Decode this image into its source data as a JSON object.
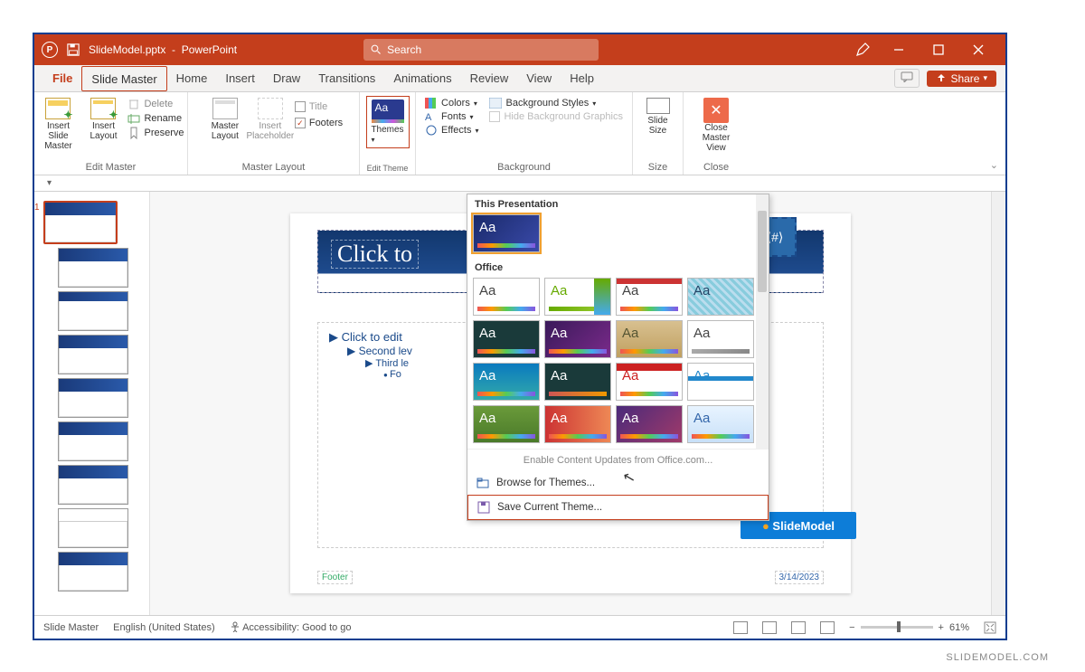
{
  "title": {
    "filename": "SlideModel.pptx",
    "app": "PowerPoint",
    "search_placeholder": "Search"
  },
  "tabs": {
    "file": "File",
    "slide_master": "Slide Master",
    "home": "Home",
    "insert": "Insert",
    "draw": "Draw",
    "transitions": "Transitions",
    "animations": "Animations",
    "review": "Review",
    "view": "View",
    "help": "Help",
    "share": "Share"
  },
  "ribbon": {
    "edit_master": {
      "label": "Edit Master",
      "insert_slide_master": "Insert Slide\nMaster",
      "insert_layout": "Insert\nLayout",
      "delete": "Delete",
      "rename": "Rename",
      "preserve": "Preserve"
    },
    "master_layout": {
      "label": "Master Layout",
      "master_layout_btn": "Master\nLayout",
      "insert_placeholder": "Insert\nPlaceholder",
      "title": "Title",
      "footers": "Footers"
    },
    "edit_theme": {
      "label": "Edit Theme",
      "themes": "Themes"
    },
    "background": {
      "label": "Background",
      "colors": "Colors",
      "fonts": "Fonts",
      "effects": "Effects",
      "bg_styles": "Background Styles",
      "hide_bg": "Hide Background Graphics"
    },
    "size": {
      "label": "Size",
      "slide_size": "Slide\nSize"
    },
    "close": {
      "label": "Close",
      "close_master": "Close\nMaster View"
    }
  },
  "themes_dropdown": {
    "this_presentation": "This Presentation",
    "office": "Office",
    "enable_updates": "Enable Content Updates from Office.com...",
    "browse": "Browse for Themes...",
    "save_current": "Save Current Theme..."
  },
  "slide": {
    "title_ph": "Click to",
    "body_l1": "Click to edit",
    "body_l2": "Second lev",
    "body_l3": "Third le",
    "body_l4": "Fo",
    "footer": "Footer",
    "date": "3/14/2023",
    "page_badge": "⟨#⟩"
  },
  "slidemodel_label": "SlideModel",
  "thumb_number": "1",
  "status": {
    "mode": "Slide Master",
    "lang": "English (United States)",
    "acc": "Accessibility: Good to go",
    "zoom": "61%"
  },
  "attribution": "SLIDEMODEL.COM"
}
